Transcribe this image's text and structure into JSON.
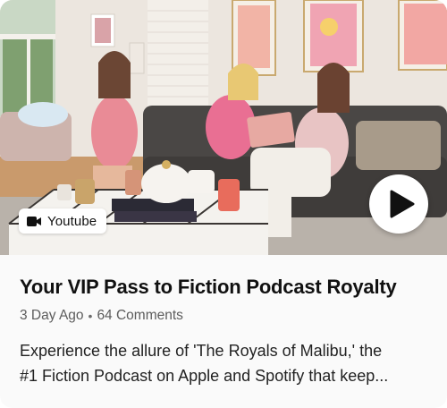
{
  "card": {
    "source_badge": {
      "icon": "video-camera-icon",
      "label": "Youtube"
    },
    "play_button": {
      "icon": "play-icon"
    },
    "title": "Your VIP Pass to Fiction Podcast Royalty",
    "meta": {
      "age": "3 Day Ago",
      "separator": "•",
      "comments": "64 Comments"
    },
    "description": {
      "line1": "Experience the allure of 'The Royals of Malibu,' the",
      "line2": "#1 Fiction Podcast on Apple and Spotify that keep..."
    }
  }
}
